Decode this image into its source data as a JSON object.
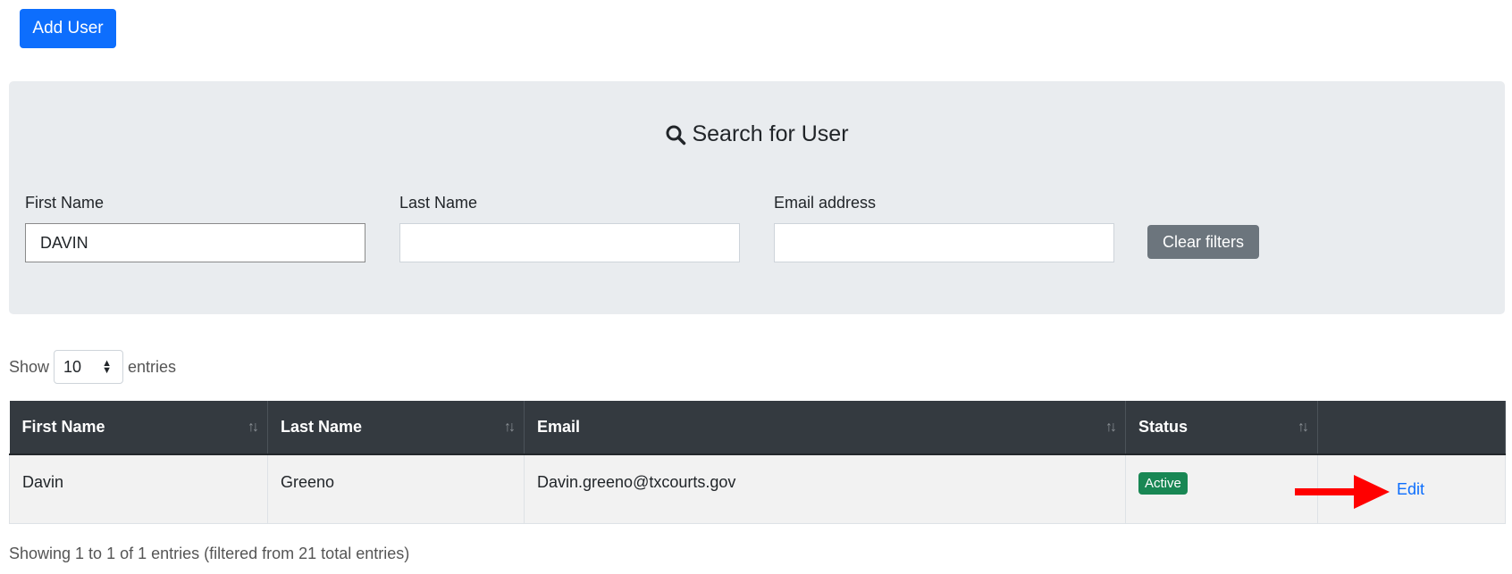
{
  "toolbar": {
    "add_user_label": "Add User"
  },
  "search": {
    "title": "Search for User",
    "first_name_label": "First Name",
    "first_name_value": "DAVIN",
    "last_name_label": "Last Name",
    "last_name_value": "",
    "email_label": "Email address",
    "email_value": "",
    "clear_label": "Clear filters"
  },
  "length": {
    "show_label": "Show",
    "value": "10",
    "entries_label": "entries"
  },
  "table": {
    "headers": [
      "First Name",
      "Last Name",
      "Email",
      "Status",
      ""
    ],
    "rows": [
      {
        "first_name": "Davin",
        "last_name": "Greeno",
        "email": "Davin.greeno@txcourts.gov",
        "status": "Active",
        "action": "Edit"
      }
    ]
  },
  "info": "Showing 1 to 1 of 1 entries (filtered from 21 total entries)",
  "colors": {
    "primary": "#0d6efd",
    "secondary": "#6c757d",
    "header_dark": "#343a40",
    "success": "#198754",
    "annotation_arrow": "#ff0000"
  },
  "icons": {
    "search": "search-icon",
    "sort": "sort-icon",
    "annotation": "red-arrow-icon"
  }
}
